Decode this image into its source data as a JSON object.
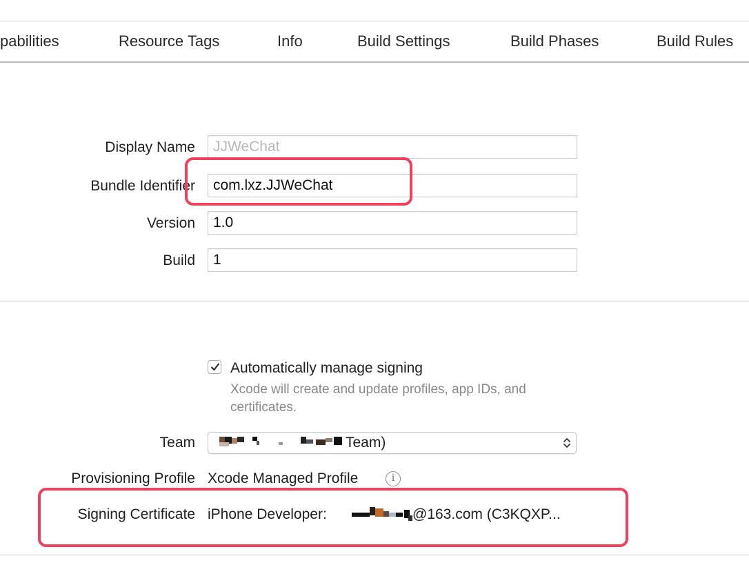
{
  "tabs": [
    {
      "label": "pabilities"
    },
    {
      "label": "Resource Tags"
    },
    {
      "label": "Info"
    },
    {
      "label": "Build Settings"
    },
    {
      "label": "Build Phases"
    },
    {
      "label": "Build Rules"
    }
  ],
  "identity": {
    "display_name_label": "Display Name",
    "display_name_placeholder": "JJWeChat",
    "bundle_identifier_label": "Bundle Identifier",
    "bundle_identifier_value": "com.lxz.JJWeChat",
    "version_label": "Version",
    "version_value": "1.0",
    "build_label": "Build",
    "build_value": "1"
  },
  "signing": {
    "auto_manage_label": "Automatically manage signing",
    "auto_manage_checked": true,
    "auto_manage_help": "Xcode will create and update profiles, app IDs, and certificates.",
    "team_label": "Team",
    "team_value_suffix": "Team)",
    "provisioning_profile_label": "Provisioning Profile",
    "provisioning_profile_value": "Xcode Managed Profile",
    "info_icon_glyph": "i",
    "signing_certificate_label": "Signing Certificate",
    "signing_certificate_prefix": "iPhone Developer:",
    "signing_certificate_suffix": "@163.com (C3KQXP..."
  },
  "colors": {
    "highlight_border": "#f0405a",
    "placeholder_text": "#b7b7b7",
    "help_text": "#888888"
  }
}
